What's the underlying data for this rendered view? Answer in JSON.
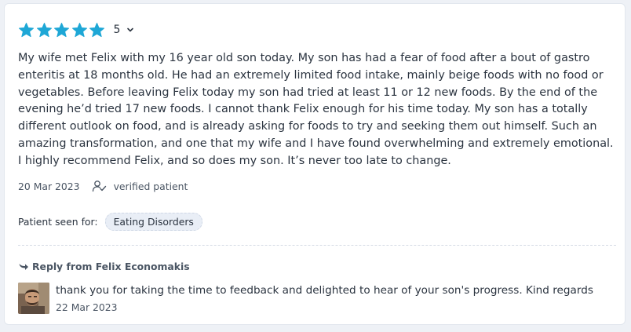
{
  "colors": {
    "star": "#1ea7d6",
    "accent": "#1f8fc8"
  },
  "rating": {
    "value": "5",
    "stars": 5,
    "icon": "star-icon"
  },
  "review": {
    "text": "My wife met Felix with my 16 year old son today. My son has had a fear of food after a bout of gastro enteritis at 18 months old. He had an extremely limited food intake, mainly beige foods with no food or vegetables. Before leaving Felix today my son had tried at least 11 or 12 new foods. By the end of the evening he’d tried 17 new foods. I cannot thank Felix enough for his time today. My son has a totally different outlook on food, and is already asking for foods to try and seeking them out himself. Such an amazing transformation, and one that my wife and I have found overwhelming and extremely emotional. I highly recommend Felix, and so does my son. It’s never too late to change.",
    "date": "20 Mar 2023",
    "verified_label": "verified patient"
  },
  "seen_for": {
    "label": "Patient seen for:",
    "tag": "Eating Disorders"
  },
  "reply": {
    "heading": "Reply from Felix Economakis",
    "text": "thank you for taking the time to feedback and delighted to hear of your son's progress. Kind regards",
    "date": "22 Mar 2023"
  }
}
